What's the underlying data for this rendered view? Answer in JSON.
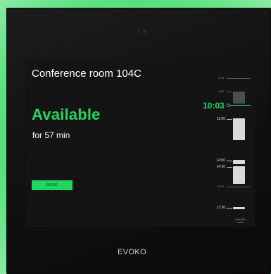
{
  "room": {
    "name": "Conference room 104C"
  },
  "status": {
    "label": "Available",
    "duration": "for 57 min",
    "color": "#1ed760"
  },
  "actions": {
    "book_label": "BOOK"
  },
  "timeline": {
    "now": "10:03",
    "labels": {
      "t0800": "8:00",
      "t0900": "9:00",
      "t1100": "11:00",
      "t1400": "14:00",
      "t1430": "14:30",
      "t1600": "16:00",
      "t1730": "17:30"
    },
    "more": "1 MORE"
  },
  "device": {
    "brand": "EVOKO"
  }
}
